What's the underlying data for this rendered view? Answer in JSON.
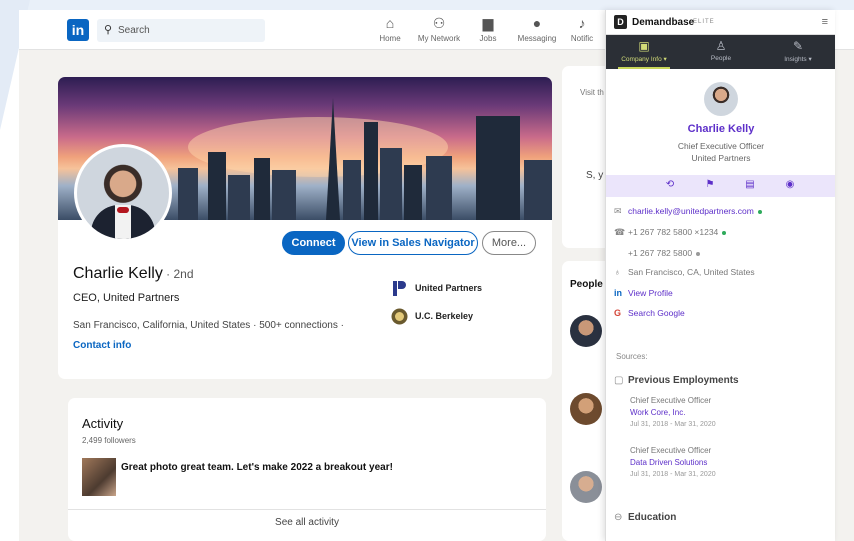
{
  "linkedin": {
    "logo": "in",
    "search_placeholder": "Search",
    "nav": [
      {
        "icon": "home-icon",
        "glyph": "⌂",
        "label": "Home"
      },
      {
        "icon": "network-icon",
        "glyph": "⚇",
        "label": "My Network"
      },
      {
        "icon": "jobs-icon",
        "glyph": "▆",
        "label": "Jobs"
      },
      {
        "icon": "messaging-icon",
        "glyph": "●",
        "label": "Messaging"
      },
      {
        "icon": "notifications-icon",
        "glyph": "♪",
        "label": "Notific"
      }
    ],
    "profile": {
      "name": "Charlie Kelly",
      "degree": " · 2nd",
      "headline": "CEO, United Partners",
      "location": "San Francisco, California, United States · 500+ connections ·",
      "contact_info": "Contact info",
      "buttons": {
        "connect": "Connect",
        "sales_nav": "View in Sales Navigator",
        "more": "More..."
      },
      "orgs": [
        {
          "name": "United Partners",
          "color": "#2b3a8c"
        },
        {
          "name": "U.C. Berkeley",
          "color": "#6a5a2e"
        }
      ]
    },
    "activity": {
      "title": "Activity",
      "followers": "2,499 followers",
      "post": "Great photo great team. Let's make 2022 a breakout year!",
      "see_all": "See all activity"
    },
    "right": {
      "visit": "Visit th",
      "s_y": "S, y",
      "people": "People"
    }
  },
  "demandbase": {
    "brand": "Demandbase",
    "tier": "ELITE",
    "menu_icon": "≡",
    "tabs": [
      {
        "label": "Company Info ▾",
        "glyph": "▣",
        "active": true
      },
      {
        "label": "People",
        "glyph": "♙",
        "active": false
      },
      {
        "label": "Insights ▾",
        "glyph": "✎",
        "active": false
      }
    ],
    "contact": {
      "name": "Charlie Kelly",
      "title": "Chief Executive Officer",
      "company": "United Partners"
    },
    "actions": [
      {
        "icon": "refresh-icon",
        "glyph": "⟲"
      },
      {
        "icon": "flag-icon",
        "glyph": "⚑"
      },
      {
        "icon": "document-icon",
        "glyph": "▤"
      },
      {
        "icon": "eye-icon",
        "glyph": "◉"
      }
    ],
    "email": "charlie.kelly@unitedpartners.com",
    "phone1": "+1 267 782 5800 ×1234",
    "phone2": "+1 267 782 5800",
    "location": "San Francisco, CA, United States",
    "view_profile": "View Profile",
    "search_google": "Search Google",
    "sources": "Sources:",
    "previous_employments_title": "Previous Employments",
    "employments": [
      {
        "title": "Chief Executive Officer",
        "company": "Work Core, Inc.",
        "dates": "Jul 31, 2018 - Mar 31, 2020"
      },
      {
        "title": "Chief Executive Officer",
        "company": "Data Driven Solutions",
        "dates": "Jul 31, 2018 - Mar 31, 2020"
      }
    ],
    "education_title": "Education",
    "colors": {
      "accent": "#5d2fc9",
      "dot_green": "#2eaa5b",
      "dot_gray": "#999999"
    }
  }
}
